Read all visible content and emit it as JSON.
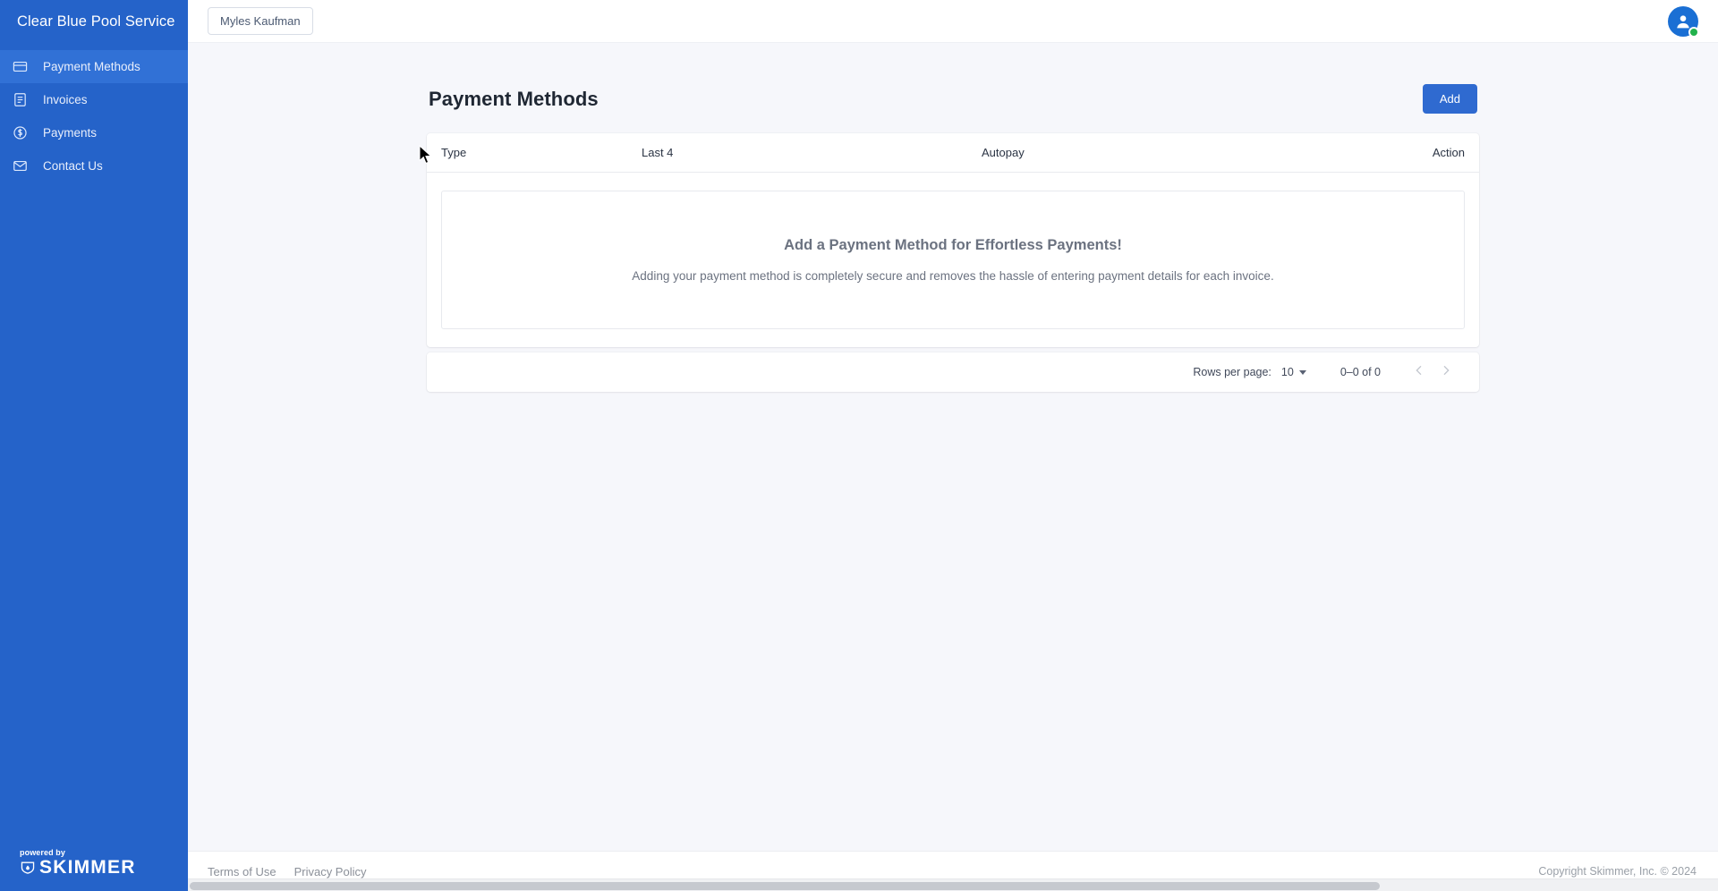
{
  "sidebar": {
    "brand": "Clear Blue Pool Service",
    "items": [
      {
        "label": "Payment Methods",
        "icon": "credit-card-icon",
        "active": true
      },
      {
        "label": "Invoices",
        "icon": "document-icon",
        "active": false
      },
      {
        "label": "Payments",
        "icon": "dollar-circle-icon",
        "active": false
      },
      {
        "label": "Contact Us",
        "icon": "envelope-icon",
        "active": false
      }
    ],
    "footer": {
      "powered_by": "powered by",
      "logo_word": "SKIMMER"
    }
  },
  "topbar": {
    "customer_name": "Myles Kaufman",
    "avatar_icon": "user-avatar-icon",
    "status": "online"
  },
  "page": {
    "title": "Payment Methods",
    "add_label": "Add"
  },
  "table": {
    "columns": [
      "Type",
      "Last 4",
      "Autopay",
      "Action"
    ],
    "rows": [],
    "empty_state": {
      "title": "Add a Payment Method for Effortless Payments!",
      "subtitle": "Adding your payment method is completely secure and removes the hassle of entering payment details for each invoice."
    }
  },
  "pagination": {
    "rows_per_page_label": "Rows per page:",
    "rows_per_page_value": "10",
    "range": "0–0 of 0",
    "prev_icon": "chevron-left-icon",
    "next_icon": "chevron-right-icon"
  },
  "footer": {
    "terms": "Terms of Use",
    "privacy": "Privacy Policy",
    "copyright": "Copyright Skimmer, Inc. © 2024"
  },
  "colors": {
    "sidebar_blue": "#2563c9",
    "sidebar_active": "#3171d6",
    "primary_button": "#2f6ad0",
    "status_green": "#22b24c",
    "page_bg": "#f6f7fb"
  }
}
